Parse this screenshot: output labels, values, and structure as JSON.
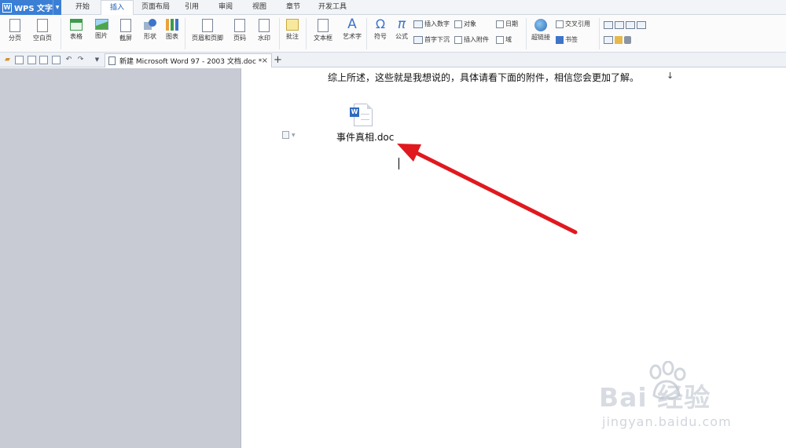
{
  "app": {
    "title": "WPS 文字"
  },
  "menu": {
    "tabs": [
      {
        "label": "开始"
      },
      {
        "label": "插入",
        "active": true
      },
      {
        "label": "页面布局"
      },
      {
        "label": "引用"
      },
      {
        "label": "审阅"
      },
      {
        "label": "视图"
      },
      {
        "label": "章节"
      },
      {
        "label": "开发工具"
      }
    ]
  },
  "ribbon": {
    "page_break": "分页",
    "blank_page": "空白页",
    "table": "表格",
    "picture": "图片",
    "screenshot": "截屏",
    "shape": "形状",
    "chart": "图表",
    "header_footer": "页眉和页脚",
    "page_number": "页码",
    "watermark": "水印",
    "comment": "批注",
    "text_box": "文本框",
    "word_art": "艺术字",
    "symbol": "符号",
    "formula": "公式",
    "insert_number": "插入数字",
    "drop_cap": "首字下沉",
    "object": "对象",
    "insert_attachment": "插入附件",
    "date": "日期",
    "field": "域",
    "hyperlink": "超链接",
    "cross_reference": "交叉引用",
    "bookmark": "书签"
  },
  "tabs": {
    "document": "新建 Microsoft Word 97 - 2003 文档.doc *",
    "close": "×",
    "new": "+"
  },
  "document": {
    "paragraph": "综上所述，这些就是我想说的，具体请看下面的附件，相信您会更加了解。",
    "paragraph_mark": "↓",
    "attachment": {
      "filename": "事件真相.doc",
      "badge": "W"
    }
  },
  "watermark": {
    "brand": "Bai 经验",
    "url": "jingyan.baidu.com"
  },
  "colors": {
    "app_blue": "#3a7fd5",
    "arrow_red": "#e0191f",
    "side_gray": "#c8cbd4"
  },
  "icons": {
    "file_attachment": "word-doc-icon",
    "arrow": "red-arrow-annotation"
  }
}
